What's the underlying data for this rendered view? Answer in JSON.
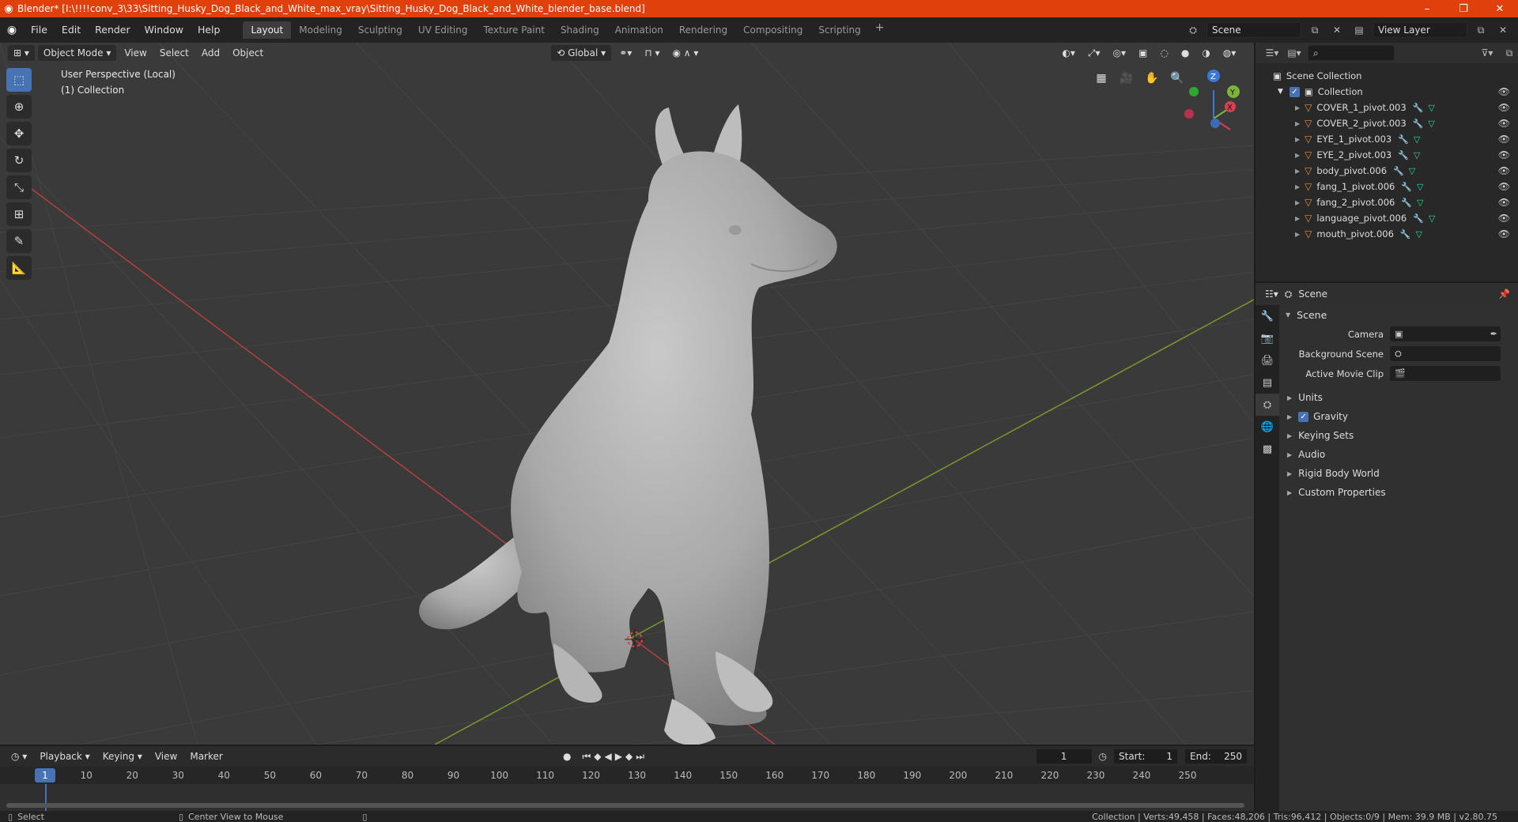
{
  "window": {
    "title": "Blender* [I:\\!!!!conv_3\\33\\Sitting_Husky_Dog_Black_and_White_max_vray\\Sitting_Husky_Dog_Black_and_White_blender_base.blend]",
    "minimize": "–",
    "maximize": "❐",
    "close": "✕"
  },
  "menu": {
    "items": [
      "File",
      "Edit",
      "Render",
      "Window",
      "Help"
    ]
  },
  "workspaces": {
    "tabs": [
      "Layout",
      "Modeling",
      "Sculpting",
      "UV Editing",
      "Texture Paint",
      "Shading",
      "Animation",
      "Rendering",
      "Compositing",
      "Scripting"
    ],
    "active": "Layout",
    "add": "+"
  },
  "scene_selector": {
    "value": "Scene"
  },
  "view_layer": {
    "value": "View Layer"
  },
  "viewport": {
    "mode": "Object Mode",
    "menus": [
      "View",
      "Select",
      "Add",
      "Object"
    ],
    "orientation": "Global",
    "info_line1": "User Perspective (Local)",
    "info_line2": "(1) Collection",
    "gizmo": {
      "x": "X",
      "y": "Y",
      "z": "Z"
    }
  },
  "timeline": {
    "menus": [
      "Playback",
      "Keying",
      "View",
      "Marker"
    ],
    "current_frame": "1",
    "start_label": "Start:",
    "start": "1",
    "end_label": "End:",
    "end": "250",
    "ruler": [
      "1",
      "10",
      "20",
      "30",
      "40",
      "50",
      "60",
      "70",
      "80",
      "90",
      "100",
      "110",
      "120",
      "130",
      "140",
      "150",
      "160",
      "170",
      "180",
      "190",
      "200",
      "210",
      "220",
      "230",
      "240",
      "250"
    ]
  },
  "outliner": {
    "root": "Scene Collection",
    "collection": "Collection",
    "objects": [
      "COVER_1_pivot.003",
      "COVER_2_pivot.003",
      "EYE_1_pivot.003",
      "EYE_2_pivot.003",
      "body_pivot.006",
      "fang_1_pivot.006",
      "fang_2_pivot.006",
      "language_pivot.006",
      "mouth_pivot.006"
    ]
  },
  "properties": {
    "header": "Scene",
    "panel": "Scene",
    "fields": [
      {
        "label": "Camera",
        "value": ""
      },
      {
        "label": "Background Scene",
        "value": ""
      },
      {
        "label": "Active Movie Clip",
        "value": ""
      }
    ],
    "subpanels": [
      "Units",
      "Gravity",
      "Keying Sets",
      "Audio",
      "Rigid Body World",
      "Custom Properties"
    ]
  },
  "statusbar": {
    "left1": "Select",
    "left2": "Center View to Mouse",
    "right": "Collection | Verts:49,458 | Faces:48,206 | Tris:96,412 | Objects:0/9 | Mem: 39.9 MB | v2.80.75"
  },
  "colors": {
    "titlebar": "#e0400c",
    "accent": "#4772b3",
    "x_axis": "#b5403f",
    "y_axis": "#7a9a2a",
    "object_icon": "#e98f3b"
  }
}
